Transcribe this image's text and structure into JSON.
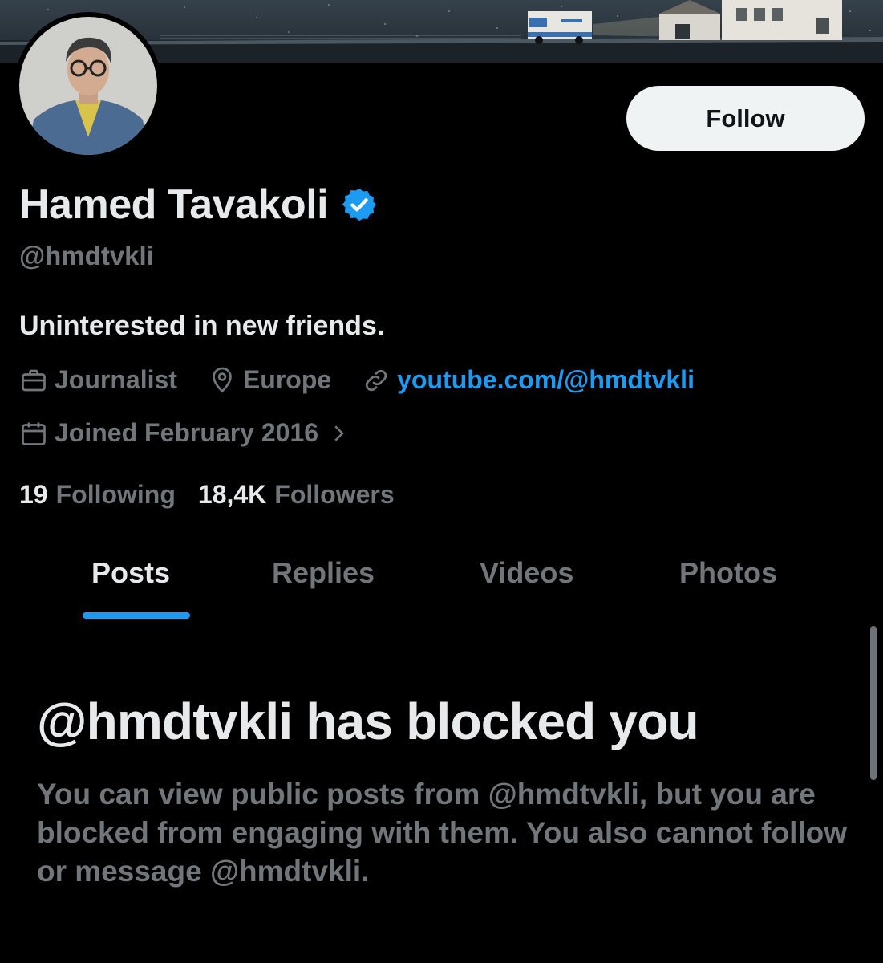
{
  "profile": {
    "follow_label": "Follow",
    "name": "Hamed Tavakoli",
    "verified": true,
    "handle": "@hmdtvkli",
    "bio": "Uninterested in new friends.",
    "profession": "Journalist",
    "location": "Europe",
    "website": "youtube.com/@hmdtvkli",
    "joined": "Joined February 2016",
    "following_count": "19",
    "following_label": "Following",
    "followers_count": "18,4K",
    "followers_label": "Followers"
  },
  "tabs": [
    {
      "label": "Posts",
      "active": true
    },
    {
      "label": "Replies",
      "active": false
    },
    {
      "label": "Videos",
      "active": false
    },
    {
      "label": "Photos",
      "active": false
    }
  ],
  "blocked": {
    "title": "@hmdtvkli has blocked you",
    "description": "You can view public posts from @hmdtvkli, but you are blocked from engaging with them. You also cannot follow or message @hmdtvkli."
  },
  "colors": {
    "accent": "#1d9bf0",
    "background": "#000000",
    "primary_text": "#e7e9ea",
    "secondary_text": "#71767b",
    "button_bg": "#eff3f4"
  },
  "icons": {
    "verified": "verified-badge-icon",
    "profession": "briefcase-icon",
    "location": "map-pin-icon",
    "website": "link-icon",
    "joined": "calendar-icon",
    "joined_more": "chevron-right-icon"
  }
}
